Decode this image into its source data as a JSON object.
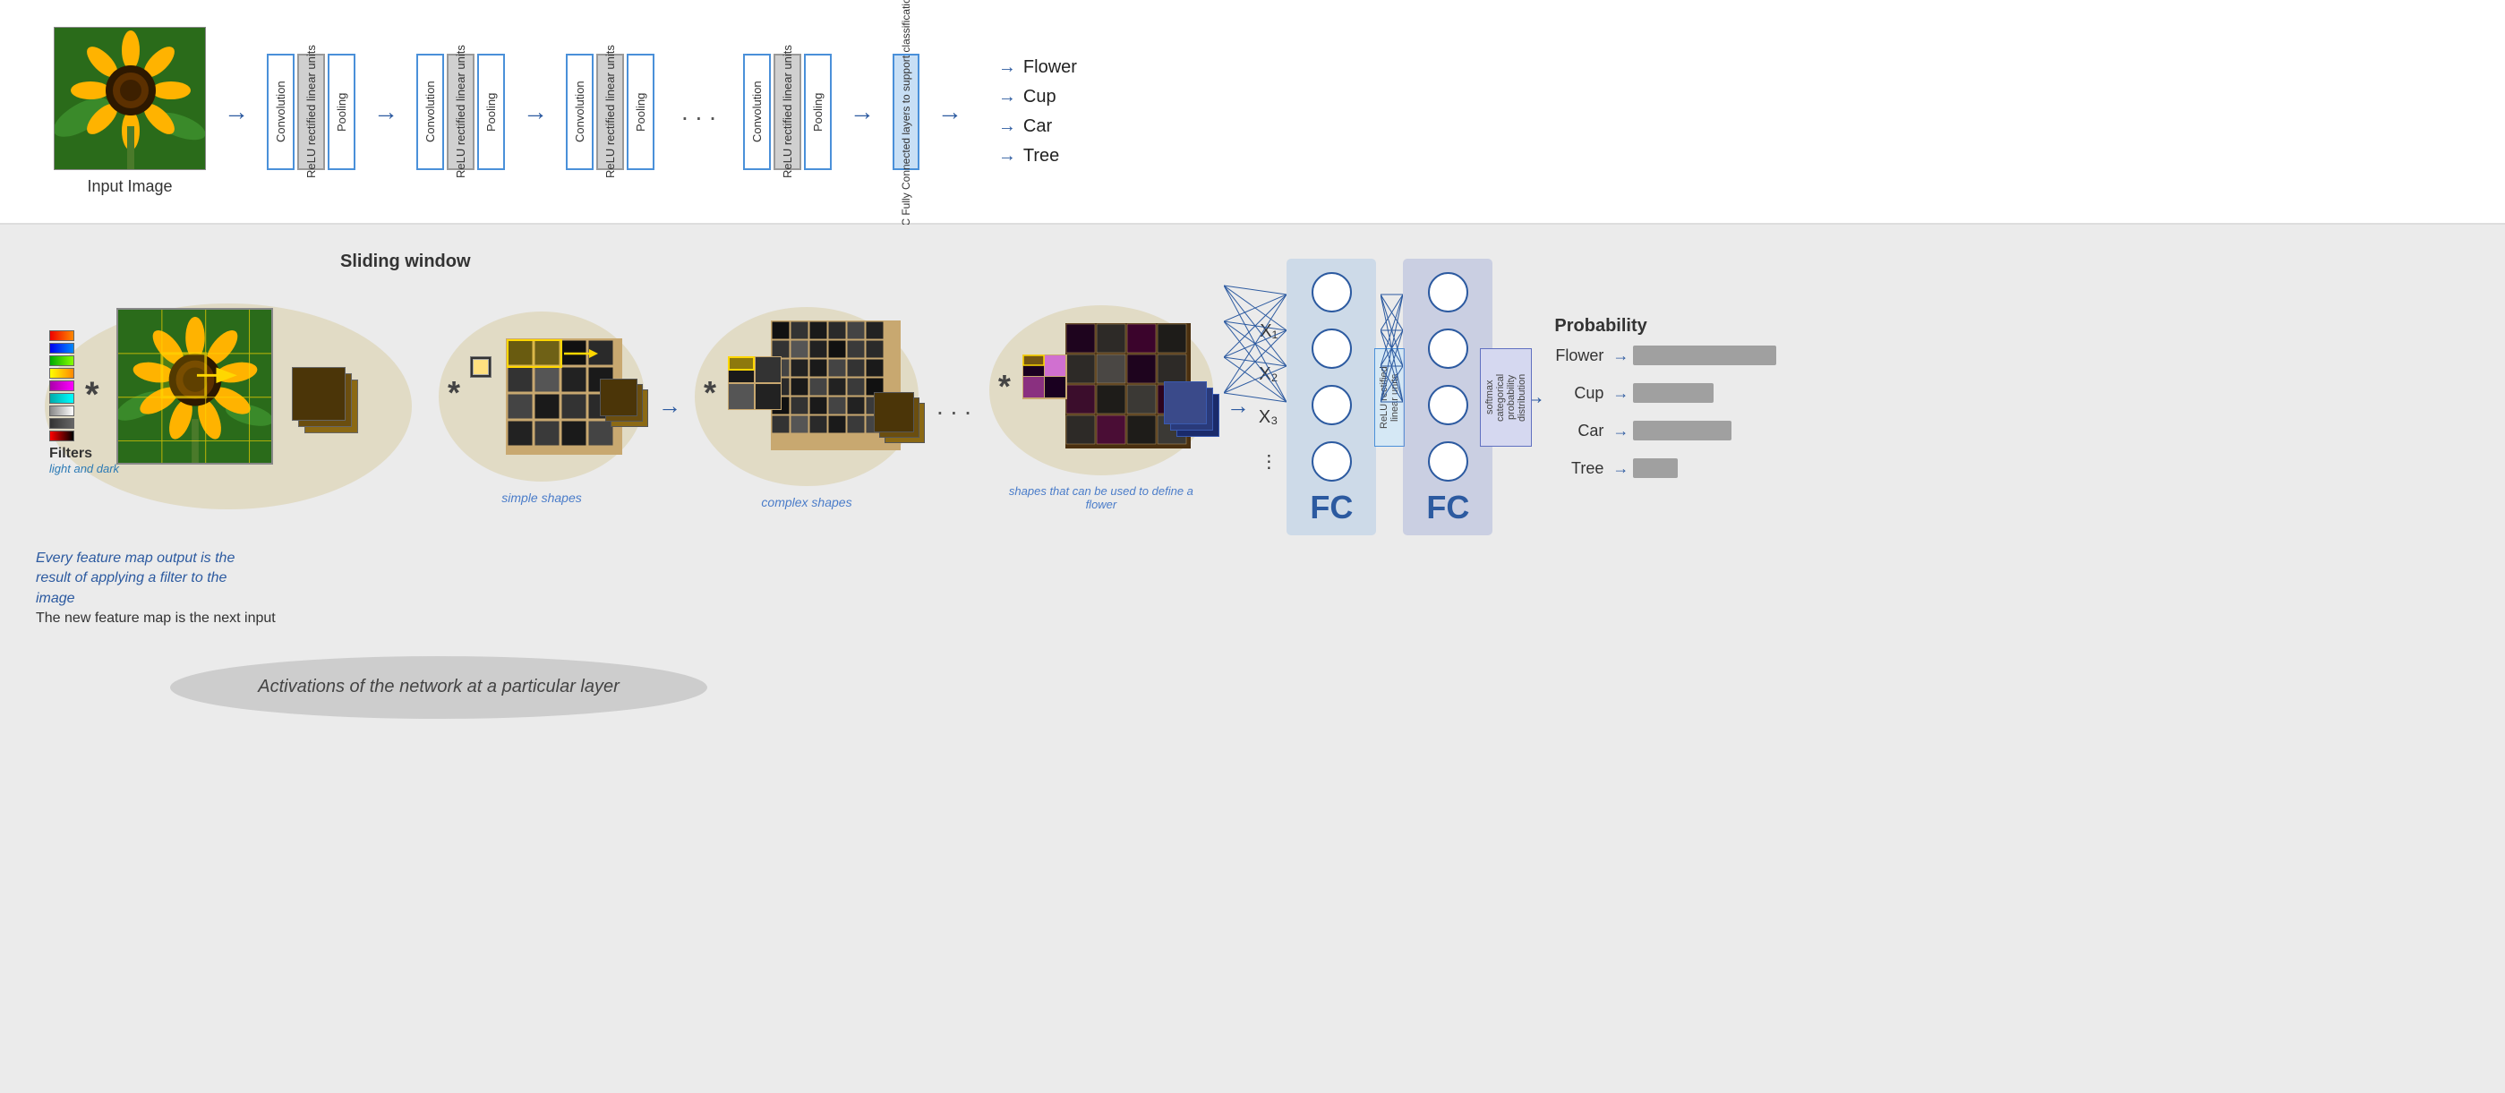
{
  "top": {
    "input_label": "Input Image",
    "blocks": [
      {
        "layers": [
          "Convolution",
          "ReLU rectified linear units",
          "Pooling"
        ]
      },
      {
        "layers": [
          "Convolution",
          "ReLU rectified linear units",
          "Pooling"
        ]
      },
      {
        "layers": [
          "Convolution",
          "ReLU rectified linear units",
          "Pooling"
        ]
      },
      {
        "layers": [
          "Convolution",
          "ReLU rectified linear units",
          "Pooling"
        ]
      }
    ],
    "fc_block": {
      "label": "FC",
      "sublabel": "Fully Connected layers to support classification"
    },
    "outputs": [
      "Flower",
      "Cup",
      "Car",
      "Tree"
    ]
  },
  "bottom": {
    "sliding_window_label": "Sliding window",
    "filters_label": "Filters",
    "filters_sublabel": "light and dark",
    "feature_labels": [
      "simple shapes",
      "complex shapes",
      "shapes that can be used to define a flower"
    ],
    "italic_desc": "Every feature map output is the result of applying a filter to the image",
    "italic_desc2": "The new feature map is the next input",
    "activations_label": "Activations of the network at a particular layer",
    "inputs": [
      "X₁",
      "X₂",
      "X₃"
    ],
    "dots": "...",
    "fc_label": "FC",
    "prob_title": "Probability",
    "outputs": [
      {
        "label": "Flower",
        "width": 160
      },
      {
        "label": "Cup",
        "width": 90
      },
      {
        "label": "Car",
        "width": 110
      },
      {
        "label": "Tree",
        "width": 50
      }
    ]
  }
}
